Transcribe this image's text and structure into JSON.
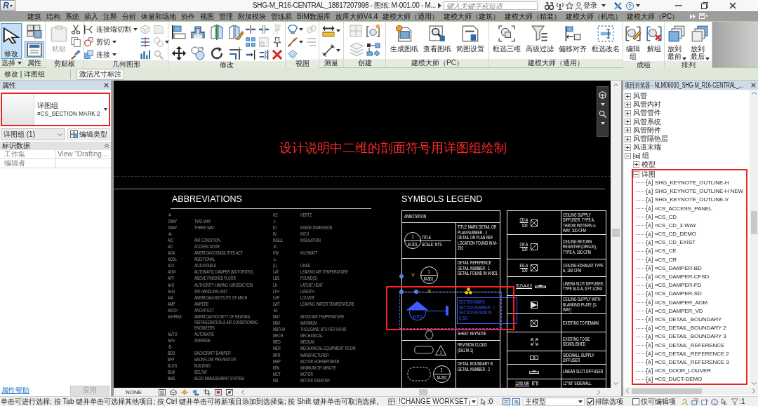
{
  "app": {
    "logo": "R",
    "title": "SHG-M_R16-CENTRAL_18817207998 - 图纸: M-001.00 - M...",
    "search": {
      "placeholder": "键入关键字或短语"
    },
    "sign_in": "登录",
    "help": "?"
  },
  "tabs": [
    {
      "label": "建筑",
      "selected": false
    },
    {
      "label": "结构",
      "selected": false
    },
    {
      "label": "系统",
      "selected": false
    },
    {
      "label": "插入",
      "selected": false
    },
    {
      "label": "注释",
      "selected": false
    },
    {
      "label": "分析",
      "selected": false
    },
    {
      "label": "体量和场地",
      "selected": false
    },
    {
      "label": "协作",
      "selected": false
    },
    {
      "label": "视图",
      "selected": false
    },
    {
      "label": "管理",
      "selected": false
    },
    {
      "label": "附加模块",
      "selected": false
    },
    {
      "label": "管练易",
      "selected": false
    },
    {
      "label": "BIM数据库",
      "selected": false
    },
    {
      "label": "族库大师V4.4",
      "selected": false
    },
    {
      "label": "建模大师（通用）",
      "selected": false
    },
    {
      "label": "建模大师（建筑）",
      "selected": false
    },
    {
      "label": "建模大师（精装）",
      "selected": false
    },
    {
      "label": "建模大师（机电）",
      "selected": false
    },
    {
      "label": "建模大师（PC）",
      "selected": false
    }
  ],
  "ribbon": {
    "panels": [
      {
        "label": "选择",
        "menu": true,
        "items": [
          {
            "kind": "large",
            "label": "修改",
            "on": true
          }
        ]
      },
      {
        "label": "属性",
        "items": [
          {
            "kind": "tall",
            "on": false
          },
          {
            "kind": "tall",
            "on": true
          }
        ]
      },
      {
        "label": "剪贴板",
        "items": [
          {
            "kind": "large",
            "label": "粘贴",
            "disabled": true
          }
        ]
      },
      {
        "label": "几何图形",
        "items": [
          {
            "kind": "small",
            "label": "连接端切割",
            "menu": true
          },
          {
            "kind": "small",
            "label": "剪切",
            "menu": true
          },
          {
            "kind": "small",
            "label": "连接",
            "menu": true
          }
        ]
      },
      {
        "label": "修改"
      },
      {
        "label": "视图"
      },
      {
        "label": "测量"
      },
      {
        "label": "创建"
      },
      {
        "label": "建模大师（PC）",
        "items": [
          {
            "kind": "large",
            "label": "生成图纸"
          },
          {
            "kind": "large",
            "label": "查看图纸"
          },
          {
            "kind": "large",
            "label": "简图设置"
          }
        ]
      },
      {
        "label": "建模大师（通用）",
        "items": [
          {
            "kind": "large",
            "label": "框选三维"
          },
          {
            "kind": "large",
            "label": "高级过滤"
          },
          {
            "kind": "large",
            "label": "偏移对齐"
          },
          {
            "kind": "large",
            "label": "框选改名"
          }
        ]
      },
      {
        "label": "成组",
        "items": [
          {
            "kind": "stacked",
            "label": "编辑组"
          },
          {
            "kind": "stacked",
            "label": "解组"
          }
        ]
      },
      {
        "label": "排列",
        "items": [
          {
            "kind": "stacked",
            "label": "放到最前",
            "menu": true
          },
          {
            "kind": "stacked",
            "label": "放到最后",
            "menu": true
          }
        ]
      }
    ]
  },
  "options_bar": {
    "context": "修改 | 详图组",
    "buttons": [
      {
        "label": "激活尺寸标注"
      }
    ]
  },
  "properties": {
    "title": "属性",
    "type_selector": {
      "family": "详图组",
      "type": "¤CS_SECTION MARK 2",
      "highlighted": true
    },
    "filter": "详图组 (1)",
    "edit_type": "编辑类型",
    "groups": [
      {
        "label": "标识数据",
        "expanded": true,
        "rows": [
          {
            "name": "工作集",
            "value": "View \"Drafting...",
            "read_only": true
          },
          {
            "name": "编辑者",
            "read_only": true
          }
        ]
      }
    ],
    "help_link": "属性帮助",
    "apply": {
      "label": "应用",
      "disabled": true
    }
  },
  "canvas": {
    "note": "设计说明中二维的剖面符号用详图组绘制",
    "abbreviations": {
      "title": "ABBREVIATIONS",
      "columns": [
        [
          {
            "abbr": "-#-"
          },
          {
            "abbr": "2WAY",
            "meaning": "TWO-WAY"
          },
          {
            "abbr": "3WAY",
            "meaning": "THREE-WAY"
          },
          {
            "abbr": "-A-"
          },
          {
            "abbr": "A/C",
            "meaning": "AIR CONDITION"
          },
          {
            "abbr": "AD",
            "meaning": "ACCESS DOOR"
          },
          {
            "abbr": "ADA",
            "meaning": "AMERICAN DISABILITIES ACT"
          },
          {
            "abbr": "ADDL",
            "meaning": "ADDITIONAL"
          },
          {
            "abbr": "ADJ",
            "meaning": "ADJUSTABLE"
          },
          {
            "abbr": "ADM",
            "meaning": "AUTOMATIC DAMPER (MOTORIZED)"
          },
          {
            "abbr": "AFF",
            "meaning": "ABOVE FINISHED FLOOR"
          },
          {
            "abbr": "AHJ",
            "meaning": "AUTHORITY HAVING JURISDICTION"
          },
          {
            "abbr": "AHU",
            "meaning": "AIR HANDLING UNIT"
          },
          {
            "abbr": "AIA",
            "meaning": "AMERICAN INSTITUTE OF ARCH"
          },
          {
            "abbr": "AMP",
            "meaning": "AMPERE"
          },
          {
            "abbr": "ARCH",
            "meaning": "ARCHITECT"
          },
          {
            "abbr": "ASHRAE",
            "meaning": "AMERICAN SOCIETY OF HEATING, REFRIGERATION & AIR CONDITIONING ENGINEERS"
          },
          {
            "abbr": "AUTO",
            "meaning": "AUTOMATIC"
          },
          {
            "abbr": "AVG",
            "meaning": "AVERAGE"
          },
          {
            "abbr": "-B-"
          },
          {
            "abbr": "BDD",
            "meaning": "BACKDRAFT DAMPER"
          },
          {
            "abbr": "BFP",
            "meaning": "BACKFLOW PREVENTOR"
          },
          {
            "abbr": "BLDG",
            "meaning": "BUILDING"
          },
          {
            "abbr": "BLW",
            "meaning": "BELOW"
          },
          {
            "abbr": "BMS",
            "meaning": "BLDG MANAGEMENT SYSTEM"
          }
        ],
        [
          {
            "abbr": "HZ",
            "meaning": "HERTZ"
          },
          {
            "abbr": "-I-"
          },
          {
            "abbr": "ID",
            "meaning": "INSIDE DIMENSION"
          },
          {
            "abbr": "IN",
            "meaning": "INCH"
          },
          {
            "abbr": "INSUL",
            "meaning": "INSULATION"
          },
          {
            "abbr": "-K-"
          },
          {
            "abbr": "KW",
            "meaning": "KILOWATT"
          },
          {
            "abbr": "-L-"
          },
          {
            "abbr": "(L)",
            "meaning": "LINED"
          },
          {
            "abbr": "LAT",
            "meaning": "LEAVING AIR TEMPERATURE"
          },
          {
            "abbr": "LBS",
            "meaning": "POUND(S)"
          },
          {
            "abbr": "LH",
            "meaning": "LATENT HEAT"
          },
          {
            "abbr": "LTH",
            "meaning": "LENGTH"
          },
          {
            "abbr": "LVR",
            "meaning": "LOUVER"
          },
          {
            "abbr": "LWT",
            "meaning": "LEAVING WATER TEMPERATURE"
          },
          {
            "abbr": "-M-"
          },
          {
            "abbr": "MAT",
            "meaning": "MIXED AIR TEMPERATURE"
          },
          {
            "abbr": "MAX",
            "meaning": "MAXIMUM"
          },
          {
            "abbr": "MBTUH",
            "meaning": "THOUSAND BTU PER HOUR"
          },
          {
            "abbr": "MECH",
            "meaning": "MECHANICAL"
          },
          {
            "abbr": "MED",
            "meaning": "MEDIUM"
          },
          {
            "abbr": "MER",
            "meaning": "MECHANICAL EQUIPMENT ROOM"
          },
          {
            "abbr": "MFR",
            "meaning": "MANUFACTURER"
          },
          {
            "abbr": "MHP",
            "meaning": "MOTOR HORSEPOWER"
          },
          {
            "abbr": "MIN",
            "meaning": "MINIMUM OR MINUTE"
          },
          {
            "abbr": "MOT",
            "meaning": "MOTOR"
          },
          {
            "abbr": "MS",
            "meaning": "MOTOR STARTER"
          }
        ]
      ]
    },
    "symbols_legend": {
      "title": "SYMBOLS LEGEND",
      "annotation_header": "ANNOTATION",
      "annotation_rows": [
        {
          "kind": "title_mark",
          "number": "1",
          "sheet": "M-201",
          "title": "TITLE",
          "scale": "SCALE: NTS",
          "description": "TITLE MARK DETAIL OR PLAN NUMBER - 1 DETAIL OR PLAN REF LOCATION FOUND IN M-201",
          "selected": false
        },
        {
          "kind": "detail_reference",
          "number": "1",
          "sheet": "M-501",
          "description": "DETAIL REFERENCE DETAIL NUMBER - 1 DETAIL FOUND IN M-501",
          "selected": false
        },
        {
          "kind": "section_mark",
          "sheet": "M-501",
          "description": "SECTION MARK SECTION NUMBER - 1 SECTION FOUND IN E-501",
          "selected": true,
          "highlighted": true,
          "axis_labels": [
            "Y",
            "X"
          ]
        },
        {
          "kind": "sheet_keynote",
          "description": "SHEET KEYNOTE",
          "selected": false
        },
        {
          "kind": "revision_cloud",
          "number": "1",
          "description": "REVISION CLOUD (DELTA 1)",
          "selected": false
        },
        {
          "kind": "detail_boundary",
          "number": "2",
          "sheet": "M-201",
          "description": "DETAIL BOUNDARY B DETAIL NUMBER - 2",
          "selected": false
        }
      ],
      "device_rows": [
        {
          "kind": "supply_diffuser",
          "tag": "CD-A",
          "cfm": "100",
          "description": "CEILING SUPPLY DIFFUSER, TYPE A, THROW PATTERN 4-WAY, 100 CFM"
        },
        {
          "kind": "return_register",
          "tag": "CR-A",
          "cfm": "100",
          "description": "CEILING RETURN REGISTER (GRILLE), TYPE A, 100 CFM"
        },
        {
          "kind": "exhaust",
          "tag": "EG-A",
          "cfm": "100",
          "description": "CEILING EXHAUST TYPE A, 100 CFM"
        },
        {
          "kind": "slot_diffuser",
          "tag": "SLD-A-6.0",
          "description": "LINERA SLOT DIFFUSER, TYPE SLD-A, 6 FT LONG"
        },
        {
          "kind": "blanked_diffuser",
          "description": "CEILING SUPPLY WITH BLANKING PLATE (3-WAY)"
        },
        {
          "kind": "existing",
          "description": "EXISTING TO REMAIN"
        },
        {
          "kind": "demolished",
          "description": "EXISTING TO BE DEMOLISHED"
        },
        {
          "kind": "sidewall_diffuser",
          "description": "SIDEWALL SUPPLY DIFFUSER"
        },
        {
          "kind": "linear_slot",
          "description": "LINEAR SLOT DIFFUSER"
        },
        {
          "kind": "sidewall_grille",
          "tag": "12X6 MR",
          "description": "12\"X6\" SIDEWALL"
        }
      ]
    },
    "view_scale": "NONE"
  },
  "project_browser": {
    "title": "项目浏览器 - NLM06000_SHG-M_R16-CENTRAL_...",
    "tree": [
      {
        "children": [
          {
            "label": "风管",
            "expanded": false
          },
          {
            "label": "风管内衬",
            "expanded": false
          },
          {
            "label": "风管管件",
            "expanded": false
          },
          {
            "label": "风管系统",
            "expanded": false
          },
          {
            "label": "风管附件",
            "expanded": false
          },
          {
            "label": "风管隔热层",
            "expanded": false
          },
          {
            "label": "风道末端",
            "expanded": false
          }
        ]
      },
      {
        "label": "组",
        "kind": "group_category",
        "expanded": true,
        "children": [
          {
            "label": "模型",
            "expanded": false
          },
          {
            "label": "详图",
            "expanded": true,
            "highlighted": true,
            "children": [
              {
                "label": "SHG_KEYNOTE_OUTLINE-H"
              },
              {
                "label": "SHG_KEYNOTE_OUTLINE-H NEW"
              },
              {
                "label": "SHG_KEYNOTE_OUTLINE-V"
              },
              {
                "label": "¤CS_ACCESS_PANEL"
              },
              {
                "label": "¤CS_CD"
              },
              {
                "label": "¤CS_CD_3-WAY"
              },
              {
                "label": "¤CS_CD_DEMO"
              },
              {
                "label": "¤CS_CD_EXIST"
              },
              {
                "label": "¤CS_CE"
              },
              {
                "label": "¤CS_CR"
              },
              {
                "label": "¤CS_DAMPER-BD"
              },
              {
                "label": "¤CS_DAMPER-CFSD"
              },
              {
                "label": "¤CS_DAMPER-FD"
              },
              {
                "label": "¤CS_DAMPER-SD"
              },
              {
                "label": "¤CS_DAMPER_ADM"
              },
              {
                "label": "¤CS_DAMPER_VD"
              },
              {
                "label": "¤CS_DETAIL_BOUNDARY"
              },
              {
                "label": "¤CS_DETAIL_BOUNDARY 2"
              },
              {
                "label": "¤CS_DETAIL_BOUNDARY 3"
              },
              {
                "label": "¤CS_DETAIL_REFERENCE"
              },
              {
                "label": "¤CS_DETAIL_REFERENCE 2"
              },
              {
                "label": "¤CS_DETAIL_REFERENCE 3"
              },
              {
                "label": "¤CS_DOOR_LOUVER"
              },
              {
                "label": "¤CS_DUCT-DEMO"
              }
            ]
          }
        ]
      }
    ]
  },
  "status_bar": {
    "hint": "单击可进行选择; 按 Tab 键并单击可选择其他项目; 按 Ctrl 键并单击可将新项目添加到选择集; 按 Shift 键并单击可取消选择。",
    "workset": "!CHANGE WORKSET¡",
    "selection_count": ":0",
    "design_option": "主模型",
    "exclude_options": {
      "label": "排除选项",
      "checked": true
    },
    "editable_only": {
      "label": "仅可编辑项",
      "checked": false
    },
    "filter_count": ":1"
  }
}
